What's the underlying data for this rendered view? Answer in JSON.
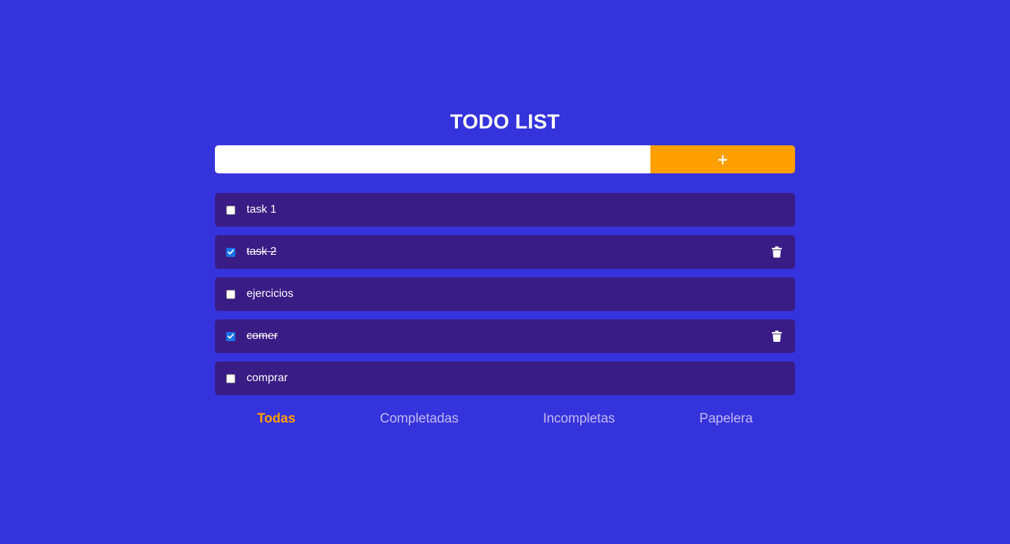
{
  "title": "TODO LIST",
  "add": {
    "input_value": "",
    "button_label": "+"
  },
  "todos": [
    {
      "text": "task 1",
      "completed": false
    },
    {
      "text": "task 2",
      "completed": true
    },
    {
      "text": "ejercicios",
      "completed": false
    },
    {
      "text": "comer",
      "completed": true
    },
    {
      "text": "comprar",
      "completed": false
    }
  ],
  "filters": {
    "all": "Todas",
    "completed": "Completadas",
    "incomplete": "Incompletas",
    "trash": "Papelera",
    "active": "all"
  },
  "icons": {
    "delete": "trash-icon",
    "checked": "checkmark-icon"
  },
  "colors": {
    "background": "#3533dc",
    "item_background": "#3a1c85",
    "accent": "#ff9f00",
    "checkbox_checked": "#1a73e8",
    "filter_inactive": "#c2b9f0"
  }
}
